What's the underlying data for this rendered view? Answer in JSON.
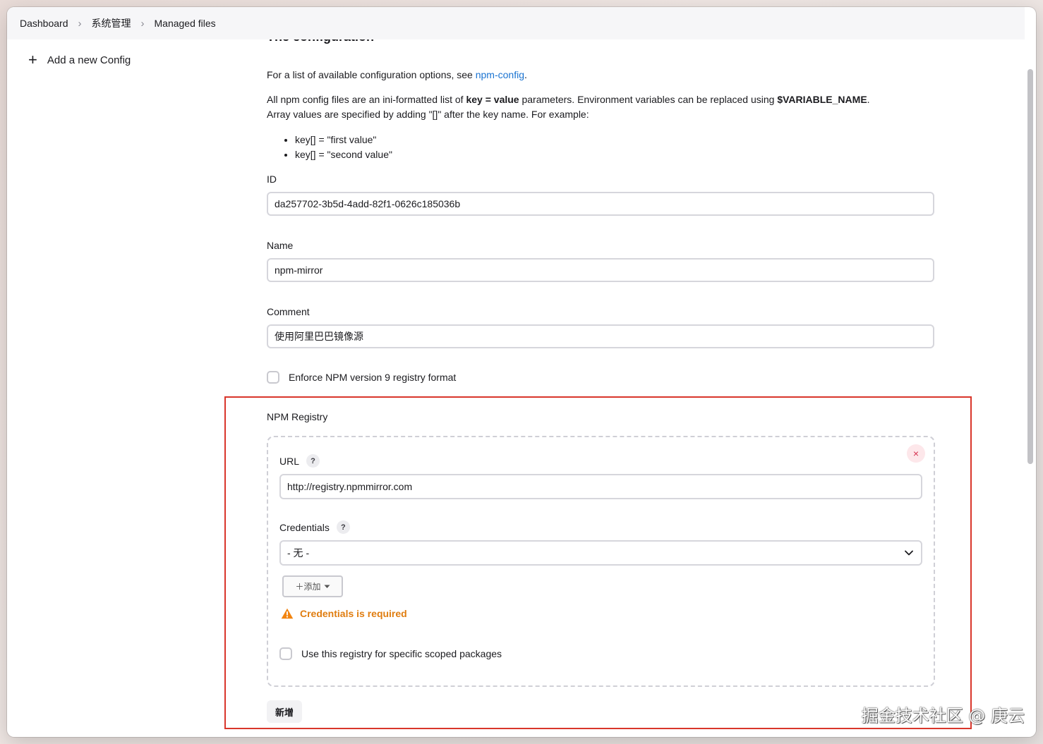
{
  "breadcrumb": [
    "Dashboard",
    "系统管理",
    "Managed files"
  ],
  "sidebar": {
    "add_config": "Add a new Config"
  },
  "config": {
    "section_title": "The configuration",
    "intro_text": "For a list of available configuration options, see ",
    "intro_link": "npm-config",
    "intro_end": ".",
    "desc_1": "All npm config files are an ini-formatted list of ",
    "desc_key": "key = value",
    "desc_2": " parameters. Environment variables can be replaced using ",
    "desc_var": "$VARIABLE_NAME",
    "desc_3": ".",
    "desc_line2": "Array values are specified by adding \"[]\" after the key name. For example:",
    "examples": [
      "key[] = \"first value\"",
      "key[] = \"second value\""
    ],
    "id_label": "ID",
    "id_value": "da257702-3b5d-4add-82f1-0626c185036b",
    "name_label": "Name",
    "name_value": "npm-mirror",
    "comment_label": "Comment",
    "comment_value": "使用阿里巴巴镜像源",
    "enforce_label": "Enforce NPM version 9 registry format",
    "enforce_checked": false
  },
  "registry": {
    "section_label": "NPM Registry",
    "url_label": "URL",
    "url_value": "http://registry.npmmirror.com",
    "credentials_label": "Credentials",
    "credentials_selected": "- 无 -",
    "add_button": "＋添加",
    "warning": "Credentials is required",
    "scoped_label": "Use this registry for specific scoped packages",
    "scoped_checked": false,
    "help_glyph": "?",
    "delete_glyph": "×"
  },
  "new_button": "新增",
  "watermark": "掘金技术社区 @ 庚云",
  "colors": {
    "link": "#1a73d1",
    "warning": "#e07d10",
    "highlight_border": "#d9362b",
    "delete": "#d6304f"
  }
}
